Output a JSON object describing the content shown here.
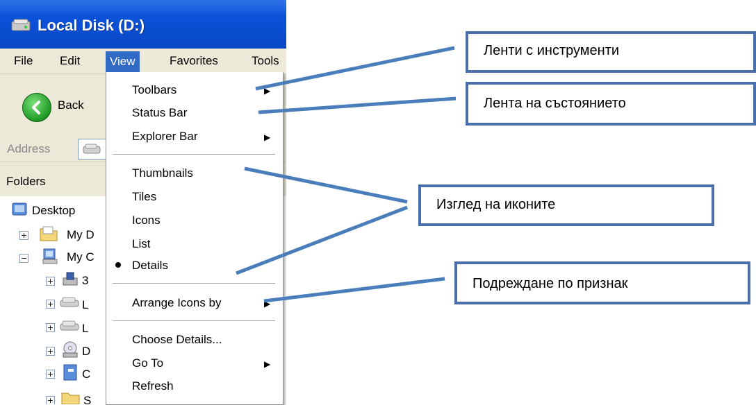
{
  "window": {
    "title": "Local Disk (D:)",
    "menu": {
      "file": "File",
      "edit": "Edit",
      "view": "View",
      "favorites": "Favorites",
      "tools": "Tools"
    },
    "toolbar": {
      "back": "Back"
    },
    "address_label": "Address",
    "folders_label": "Folders",
    "tree": {
      "desktop": "Desktop",
      "my_documents": "My D",
      "my_computer": "My C",
      "floppy": "3",
      "local1": "L",
      "local2": "L",
      "dvd": "D",
      "control": "C",
      "shared": "S"
    }
  },
  "view_menu": {
    "toolbars": "Toolbars",
    "status_bar": "Status Bar",
    "explorer_bar": "Explorer Bar",
    "thumbnails": "Thumbnails",
    "tiles": "Tiles",
    "icons": "Icons",
    "list": "List",
    "details": "Details",
    "arrange_icons_by": "Arrange Icons by",
    "choose_details": "Choose Details...",
    "go_to": "Go To",
    "refresh": "Refresh"
  },
  "callouts": {
    "toolbars": "Ленти с инструменти",
    "status_bar": "Лента на състоянието",
    "icon_view": "Изглед на иконите",
    "arrange": "Подреждане по признак"
  },
  "colors": {
    "callout_border": "#4a6ea9",
    "menu_highlight": "#316ac5",
    "titlebar": "#0b52d8"
  }
}
